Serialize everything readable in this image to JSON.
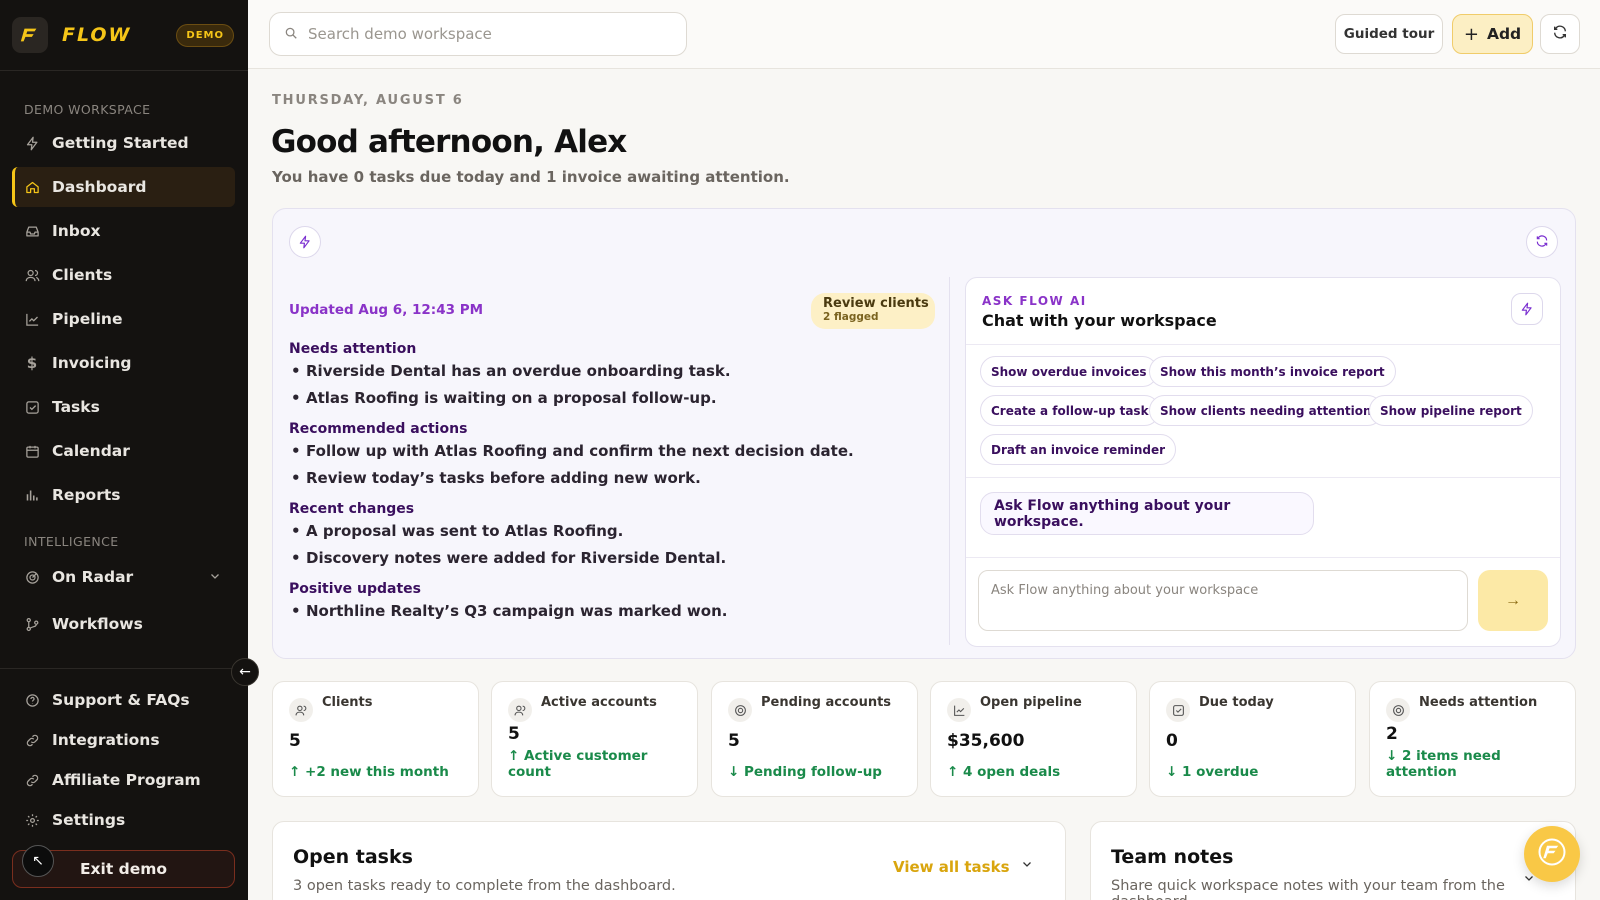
{
  "brand": {
    "name": "FLOW",
    "badge": "DEMO"
  },
  "sidebar": {
    "section_workspace": "DEMO WORKSPACE",
    "section_intelligence": "INTELLIGENCE",
    "items": [
      {
        "label": "Getting Started",
        "icon": "bolt-icon"
      },
      {
        "label": "Dashboard",
        "icon": "home-icon",
        "active": true
      },
      {
        "label": "Inbox",
        "icon": "inbox-icon"
      },
      {
        "label": "Clients",
        "icon": "users-icon"
      },
      {
        "label": "Pipeline",
        "icon": "trend-icon"
      },
      {
        "label": "Invoicing",
        "icon": "dollar-icon"
      },
      {
        "label": "Tasks",
        "icon": "checkbox-icon"
      },
      {
        "label": "Calendar",
        "icon": "calendar-icon"
      },
      {
        "label": "Reports",
        "icon": "bar-chart-icon"
      }
    ],
    "intel_items": [
      {
        "label": "On Radar",
        "icon": "radar-icon"
      },
      {
        "label": "Workflows",
        "icon": "workflow-icon"
      }
    ],
    "footer_items": [
      {
        "label": "Support & FAQs",
        "icon": "help-icon"
      },
      {
        "label": "Integrations",
        "icon": "link-icon"
      },
      {
        "label": "Affiliate Program",
        "icon": "link-icon"
      },
      {
        "label": "Settings",
        "icon": "gear-icon"
      }
    ],
    "exit_label": "Exit demo"
  },
  "topbar": {
    "search_placeholder": "Search demo workspace",
    "tour_label": "Guided tour",
    "add_label": "Add"
  },
  "header": {
    "date": "THURSDAY, AUGUST 6",
    "greeting": "Good afternoon, Alex",
    "subtitle": "You have 0 tasks due today and 1 invoice awaiting attention."
  },
  "brief": {
    "updated": "Updated Aug 6, 12:43 PM",
    "review_label": "Review clients",
    "review_count": "2 flagged",
    "sections": [
      {
        "heading": "Needs attention",
        "items": [
          "Riverside Dental has an overdue onboarding task.",
          "Atlas Roofing is waiting on a proposal follow-up."
        ]
      },
      {
        "heading": "Recommended actions",
        "items": [
          "Follow up with Atlas Roofing and confirm the next decision date.",
          "Review today’s tasks before adding new work."
        ]
      },
      {
        "heading": "Recent changes",
        "items": [
          "A proposal was sent to Atlas Roofing.",
          "Discovery notes were added for Riverside Dental."
        ]
      },
      {
        "heading": "Positive updates",
        "items": [
          "Northline Realty’s Q3 campaign was marked won."
        ]
      }
    ]
  },
  "chat": {
    "kicker": "ASK FLOW AI",
    "title": "Chat with your workspace",
    "chips": [
      "Show overdue invoices",
      "Show this month’s invoice report",
      "Create a follow-up task",
      "Show clients needing attention",
      "Show pipeline report",
      "Draft an invoice reminder"
    ],
    "bubble": "Ask Flow anything about your workspace.",
    "input_placeholder": "Ask Flow anything about your workspace"
  },
  "stats": [
    {
      "label": "Clients",
      "value": "5",
      "trend": "↑ +2 new this month",
      "icon": "users-icon"
    },
    {
      "label": "Active accounts",
      "value": "5",
      "trend": "↑ Active customer count",
      "icon": "users-icon"
    },
    {
      "label": "Pending accounts",
      "value": "5",
      "trend": "↓ Pending follow-up",
      "icon": "radar-icon"
    },
    {
      "label": "Open pipeline",
      "value": "$35,600",
      "trend": "↑ 4 open deals",
      "icon": "trend-icon"
    },
    {
      "label": "Due today",
      "value": "0",
      "trend": "↓ 1 overdue",
      "icon": "checkbox-icon"
    },
    {
      "label": "Needs attention",
      "value": "2",
      "trend": "↓ 2 items need attention",
      "icon": "radar-icon"
    }
  ],
  "tasks_panel": {
    "title": "Open tasks",
    "subtitle": "3 open tasks ready to complete from the dashboard.",
    "view_all": "View all tasks"
  },
  "notes_panel": {
    "title": "Team notes",
    "subtitle": "Share quick workspace notes with your team from the dashboard."
  },
  "colors": {
    "accent": "#f5c518",
    "purple": "#8a33c8",
    "green": "#1a8a4a",
    "sidebar_bg": "#141210"
  }
}
